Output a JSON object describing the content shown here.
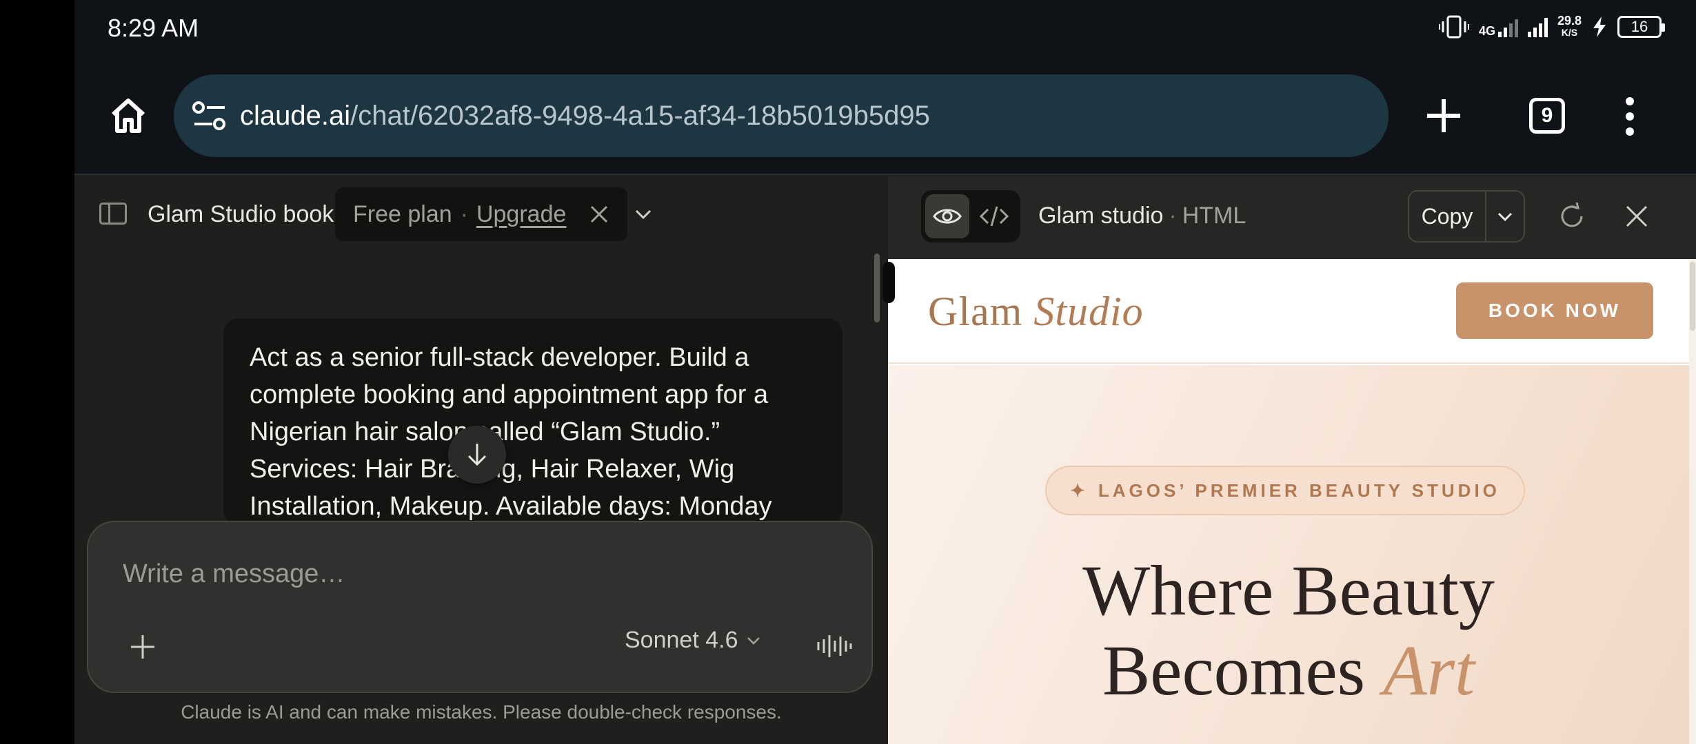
{
  "status_bar": {
    "time": "8:29 AM",
    "network_type": "4G",
    "net_speed_value": "29.8",
    "net_speed_unit": "K/S",
    "battery": "16"
  },
  "browser": {
    "url_host": "claude.ai",
    "url_path": "/chat/62032af8-9498-4a15-af34-18b5019b5d95",
    "tab_count": "9"
  },
  "chat": {
    "title": "Glam Studio book",
    "plan": {
      "label": "Free plan",
      "separator": "·",
      "upgrade": "Upgrade"
    },
    "user_message": "Act as a senior full-stack developer. Build a complete booking and appointment app for a Nigerian hair salon called “Glam Studio.” Services: Hair Braiding, Hair Relaxer, Wig Installation, Makeup. Available days: Monday",
    "composer": {
      "placeholder": "Write a message…",
      "model": "Sonnet 4.6"
    },
    "disclaimer": "Claude is AI and can make mistakes. Please double-check responses."
  },
  "artifact": {
    "title": "Glam studio",
    "separator": "·",
    "type": "HTML",
    "copy_label": "Copy"
  },
  "preview": {
    "brand_main": "Glam",
    "brand_accent": "Studio",
    "book_button": "BOOK NOW",
    "badge_icon": "✦",
    "badge_text": "LAGOS’ PREMIER BEAUTY STUDIO",
    "headline_line1": "Where Beauty",
    "headline_line2_main": "Becomes",
    "headline_line2_accent": "Art"
  },
  "colors": {
    "brand_accent": "#c8926a",
    "url_bar": "#1e3642",
    "chat_background": "#1f1f1e",
    "composer_background": "#30302e"
  },
  "icons": [
    "home-icon",
    "site-settings-icon",
    "plus-icon",
    "tabs-icon",
    "more-vert-icon",
    "sidebar-icon",
    "close-icon",
    "chevron-down-icon",
    "arrow-down-icon",
    "waveform-icon",
    "eye-icon",
    "code-icon",
    "refresh-icon",
    "sparkle-icon"
  ]
}
